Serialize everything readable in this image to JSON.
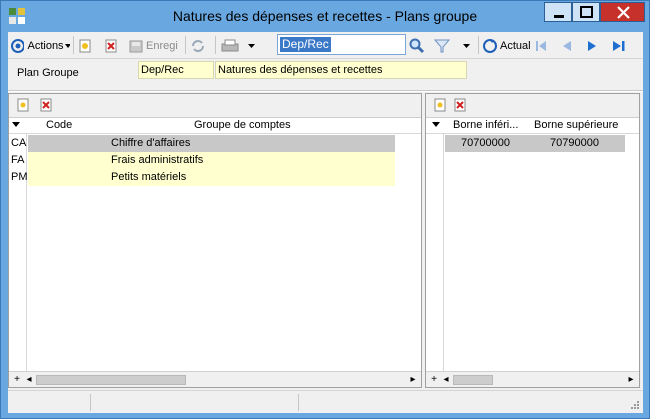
{
  "window": {
    "title": "Natures des dépenses et recettes -  Plans groupe"
  },
  "toolbar": {
    "actions_label": "Actions",
    "save_label": "Enregi",
    "search_value": "Dep/Rec",
    "actual_label": "Actual"
  },
  "form": {
    "plan_label": "Plan Groupe",
    "code_value": "Dep/Rec",
    "name_value": "Natures des dépenses et recettes"
  },
  "left_grid": {
    "columns": [
      "Code",
      "Groupe de comptes"
    ],
    "rows": [
      {
        "code": "CA",
        "group": "Chiffre d'affaires",
        "state": "selected"
      },
      {
        "code": "FA",
        "group": "Frais administratifs",
        "state": "normal"
      },
      {
        "code": "PM",
        "group": "Petits matériels",
        "state": "normal"
      }
    ]
  },
  "right_grid": {
    "columns": [
      "Borne inféri...",
      "Borne supérieure"
    ],
    "rows": [
      {
        "lower": "70700000",
        "upper": "70790000",
        "state": "selected"
      }
    ]
  },
  "colors": {
    "titlebar": "#68a7e0",
    "selected_row": "#c8c8c8",
    "normal_row": "#ffffd0",
    "accent_blue": "#1e6fd0",
    "close_button": "#c7312b"
  },
  "icons": {
    "app": "app-logo-icon",
    "actions": "actions-circle-icon",
    "new": "new-document-icon",
    "delete": "delete-icon",
    "save": "save-icon",
    "refresh": "refresh-icon",
    "print": "print-icon",
    "search": "magnifier-icon",
    "filter": "filter-icon",
    "actual": "refresh-circle-icon",
    "first": "first-record-icon",
    "prev": "previous-record-icon",
    "next": "next-record-icon",
    "last": "last-record-icon"
  }
}
